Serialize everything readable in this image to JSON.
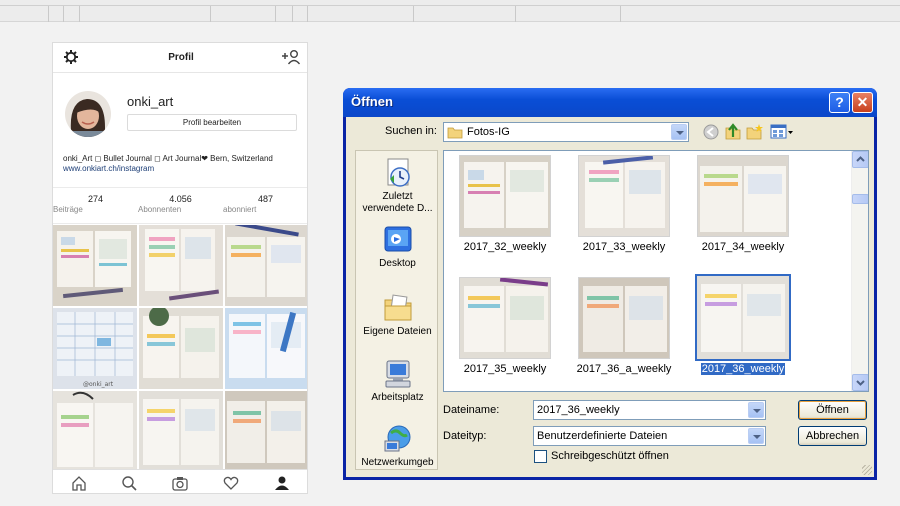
{
  "instagram": {
    "header_title": "Profil",
    "username": "onki_art",
    "edit_profile_label": "Profil bearbeiten",
    "bio": "onki_Art ◻ Bullet Journal ◻ Art Journal❤ Bern, Switzerland",
    "website": "www.onkiart.ch/instagram",
    "stats": [
      {
        "value": "274",
        "label": "Beiträge"
      },
      {
        "value": "4.056",
        "label": "Abonnenten"
      },
      {
        "value": "487",
        "label": "abonniert"
      }
    ],
    "grid_photo_captions": [
      "",
      "",
      "",
      "",
      "",
      "@onki_art",
      "",
      "",
      ""
    ],
    "bottom_nav_icons": [
      "home-icon",
      "search-icon",
      "camera-icon",
      "heart-icon",
      "profile-icon"
    ]
  },
  "dialog": {
    "title": "Öffnen",
    "help_label": "?",
    "close_label": "✕",
    "look_in_label": "Suchen in:",
    "look_in_value": "Fotos-IG",
    "places": [
      {
        "label": "Zuletzt verwendete D...",
        "icon": "recent-documents-icon"
      },
      {
        "label": "Desktop",
        "icon": "desktop-icon"
      },
      {
        "label": "Eigene Dateien",
        "icon": "my-documents-icon"
      },
      {
        "label": "Arbeitsplatz",
        "icon": "my-computer-icon"
      },
      {
        "label": "Netzwerkumgeb",
        "icon": "network-icon"
      }
    ],
    "files": [
      {
        "name": "2017_32_weekly",
        "selected": false
      },
      {
        "name": "2017_33_weekly",
        "selected": false
      },
      {
        "name": "2017_34_weekly",
        "selected": false
      },
      {
        "name": "2017_35_weekly",
        "selected": false
      },
      {
        "name": "2017_36_a_weekly",
        "selected": false
      },
      {
        "name": "2017_36_weekly",
        "selected": true
      }
    ],
    "filename_label": "Dateiname:",
    "filename_value": "2017_36_weekly",
    "filetype_label": "Dateityp:",
    "filetype_value": "Benutzerdefinierte Dateien",
    "readonly_label": "Schreibgeschützt öffnen",
    "readonly_checked": false,
    "open_button": "Öffnen",
    "cancel_button": "Abbrechen"
  },
  "colors": {
    "xp_title_blue": "#0a4ed6",
    "xp_face": "#ece9d8",
    "selection_blue": "#316ac5",
    "ig_link": "#1d3e76"
  }
}
